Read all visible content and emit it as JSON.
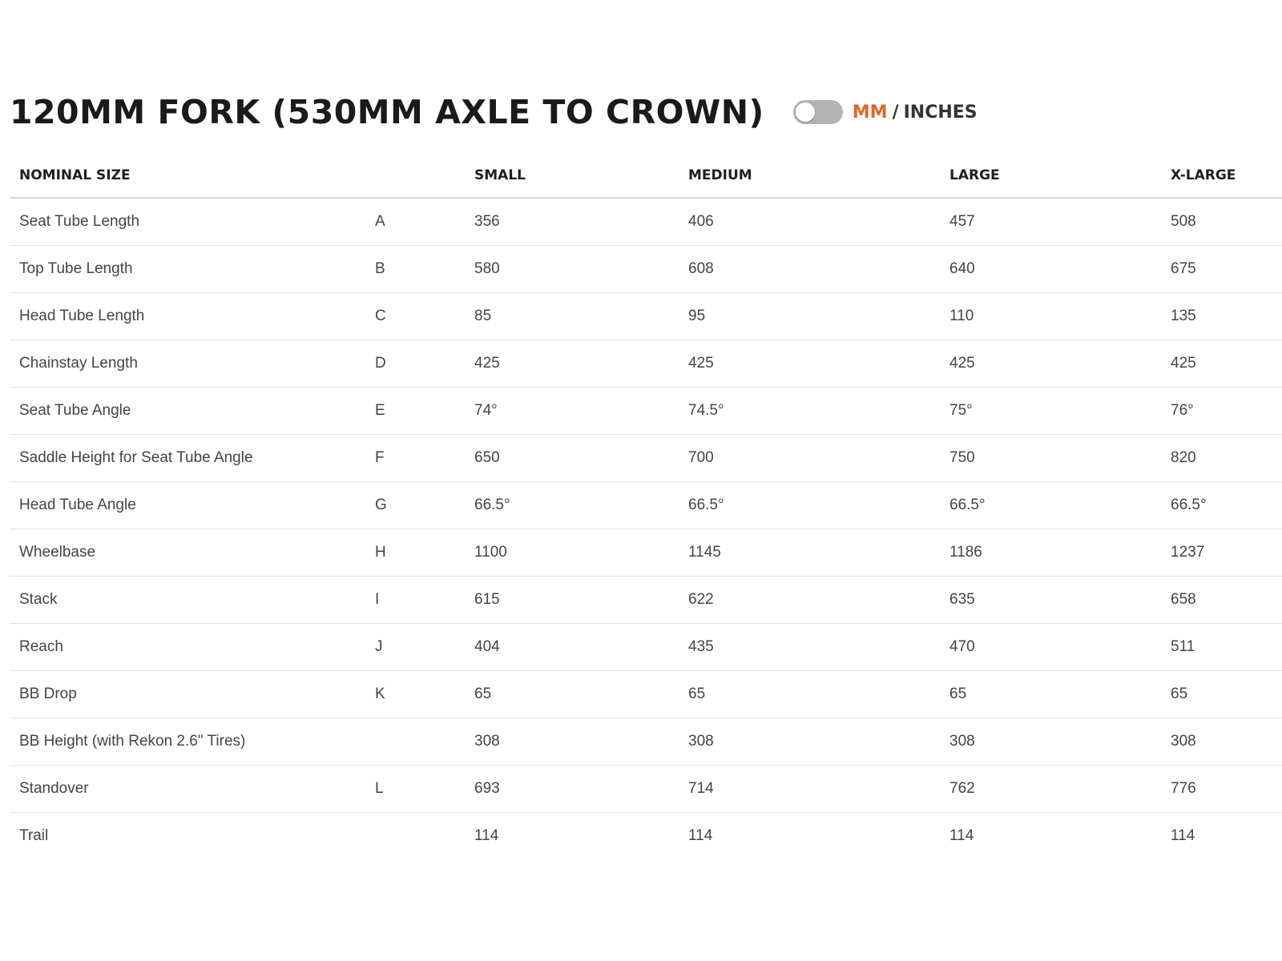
{
  "header": {
    "title": "120MM FORK (530MM AXLE TO CROWN)",
    "unit_toggle": {
      "mm_label": "MM",
      "separator": "/",
      "inches_label": "INCHES",
      "selected": "MM",
      "active_color": "#e0662a"
    }
  },
  "table": {
    "columns": [
      "NOMINAL SIZE",
      "",
      "SMALL",
      "MEDIUM",
      "LARGE",
      "X-LARGE"
    ],
    "rows": [
      {
        "name": "Seat Tube Length",
        "letter": "A",
        "values": [
          "356",
          "406",
          "457",
          "508"
        ]
      },
      {
        "name": "Top Tube Length",
        "letter": "B",
        "values": [
          "580",
          "608",
          "640",
          "675"
        ]
      },
      {
        "name": "Head Tube Length",
        "letter": "C",
        "values": [
          "85",
          "95",
          "110",
          "135"
        ]
      },
      {
        "name": "Chainstay Length",
        "letter": "D",
        "values": [
          "425",
          "425",
          "425",
          "425"
        ]
      },
      {
        "name": "Seat Tube Angle",
        "letter": "E",
        "values": [
          "74°",
          "74.5°",
          "75°",
          "76°"
        ]
      },
      {
        "name": "Saddle Height for Seat Tube Angle",
        "letter": "F",
        "values": [
          "650",
          "700",
          "750",
          "820"
        ]
      },
      {
        "name": "Head Tube Angle",
        "letter": "G",
        "values": [
          "66.5°",
          "66.5°",
          "66.5°",
          "66.5°"
        ]
      },
      {
        "name": "Wheelbase",
        "letter": "H",
        "values": [
          "1100",
          "1145",
          "1186",
          "1237"
        ]
      },
      {
        "name": "Stack",
        "letter": "I",
        "values": [
          "615",
          "622",
          "635",
          "658"
        ]
      },
      {
        "name": "Reach",
        "letter": "J",
        "values": [
          "404",
          "435",
          "470",
          "511"
        ]
      },
      {
        "name": "BB Drop",
        "letter": "K",
        "values": [
          "65",
          "65",
          "65",
          "65"
        ]
      },
      {
        "name": "BB Height (with Rekon 2.6\" Tires)",
        "letter": "",
        "values": [
          "308",
          "308",
          "308",
          "308"
        ]
      },
      {
        "name": "Standover",
        "letter": "L",
        "values": [
          "693",
          "714",
          "762",
          "776"
        ]
      },
      {
        "name": "Trail",
        "letter": "",
        "values": [
          "114",
          "114",
          "114",
          "114"
        ]
      }
    ]
  }
}
